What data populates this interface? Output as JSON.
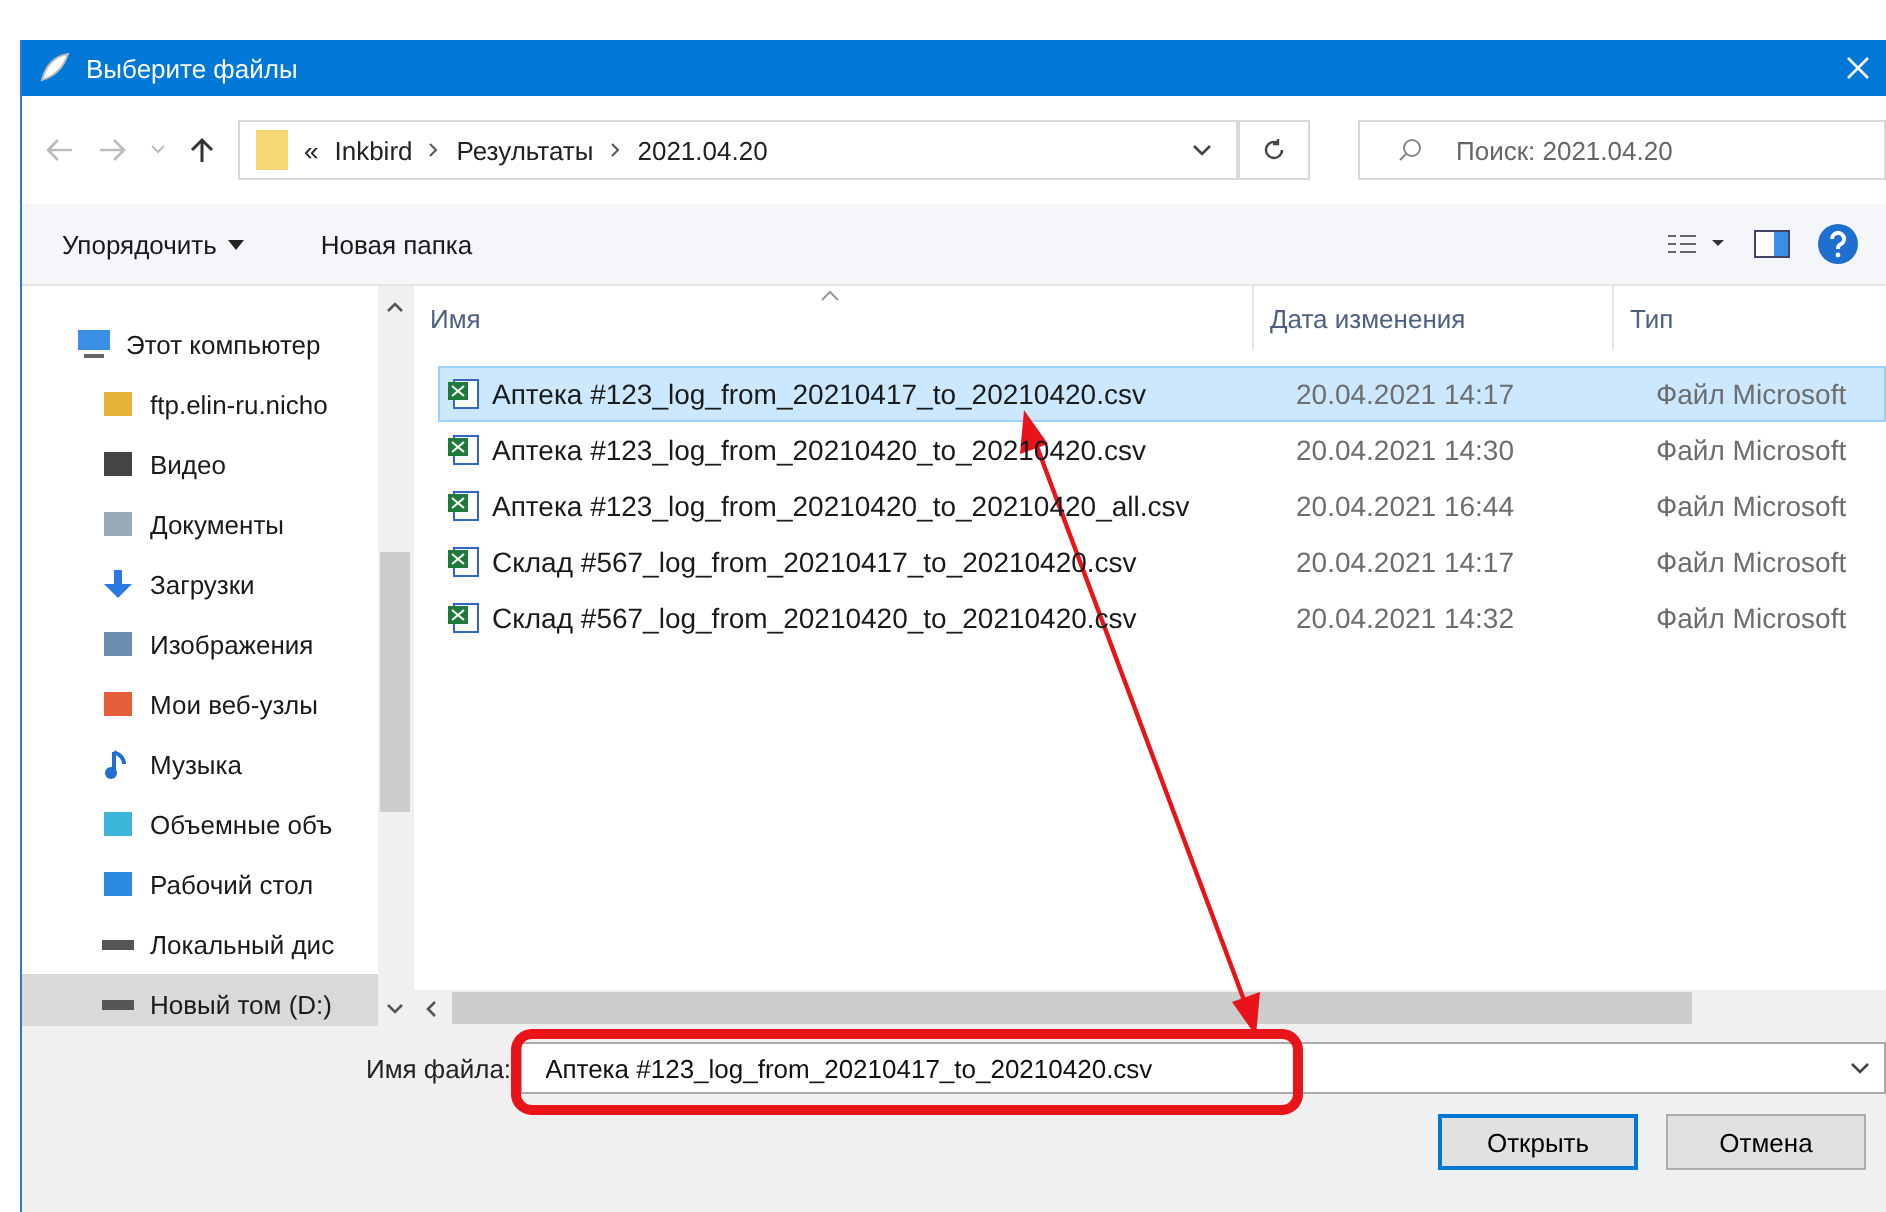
{
  "window": {
    "title": "Выберите файлы"
  },
  "address": {
    "overflow_mark": "«",
    "path": [
      "Inkbird",
      "Результаты",
      "2021.04.20"
    ]
  },
  "search": {
    "placeholder": "Поиск: 2021.04.20"
  },
  "toolbar": {
    "organize": "Упорядочить",
    "new_folder": "Новая папка"
  },
  "sidebar": {
    "items": [
      {
        "label": "Этот компьютер",
        "kind": "computer",
        "selected": false,
        "children": [
          {
            "label": "ftp.elin-ru.nicho",
            "kind": "ftp",
            "selected": false
          },
          {
            "label": "Видео",
            "kind": "video",
            "selected": false
          },
          {
            "label": "Документы",
            "kind": "documents",
            "selected": false
          },
          {
            "label": "Загрузки",
            "kind": "downloads",
            "selected": false
          },
          {
            "label": "Изображения",
            "kind": "images",
            "selected": false
          },
          {
            "label": "Мои веб-узлы",
            "kind": "web",
            "selected": false
          },
          {
            "label": "Музыка",
            "kind": "music",
            "selected": false
          },
          {
            "label": "Объемные объ",
            "kind": "objects",
            "selected": false
          },
          {
            "label": "Рабочий стол",
            "kind": "desktop",
            "selected": false
          },
          {
            "label": "Локальный дис",
            "kind": "drive",
            "selected": false
          },
          {
            "label": "Новый том (D:)",
            "kind": "drive",
            "selected": true
          }
        ]
      }
    ]
  },
  "table": {
    "columns": [
      "Имя",
      "Дата изменения",
      "Тип"
    ],
    "rows": [
      {
        "name": "Аптека #123_log_from_20210417_to_20210420.csv",
        "date": "20.04.2021 14:17",
        "type": "Файл Microsoft",
        "selected": true
      },
      {
        "name": "Аптека #123_log_from_20210420_to_20210420.csv",
        "date": "20.04.2021 14:30",
        "type": "Файл Microsoft",
        "selected": false
      },
      {
        "name": "Аптека #123_log_from_20210420_to_20210420_all.csv",
        "date": "20.04.2021 16:44",
        "type": "Файл Microsoft",
        "selected": false
      },
      {
        "name": "Склад #567_log_from_20210417_to_20210420.csv",
        "date": "20.04.2021 14:17",
        "type": "Файл Microsoft",
        "selected": false
      },
      {
        "name": "Склад #567_log_from_20210420_to_20210420.csv",
        "date": "20.04.2021 14:32",
        "type": "Файл Microsoft",
        "selected": false
      }
    ]
  },
  "filename": {
    "label": "Имя файла:",
    "value": "Аптека #123_log_from_20210417_to_20210420.csv"
  },
  "buttons": {
    "open": "Открыть",
    "cancel": "Отмена"
  }
}
